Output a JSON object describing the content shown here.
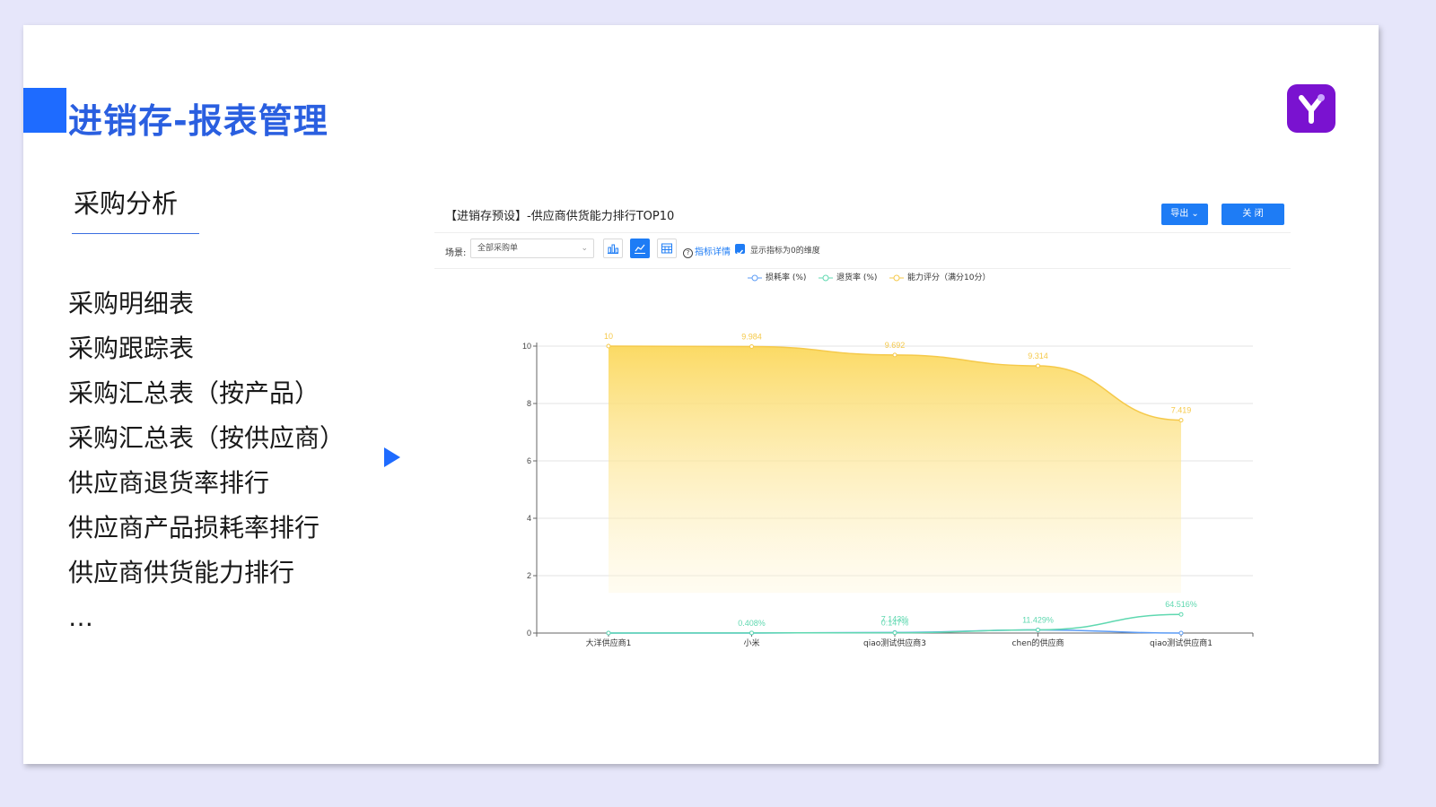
{
  "slide": {
    "title": "进销存-报表管理",
    "section_title": "采购分析",
    "menu_items": [
      "采购明细表",
      "采购跟踪表",
      "采购汇总表（按产品）",
      "采购汇总表（按供应商）",
      "供应商退货率排行",
      "供应商产品损耗率排行",
      "供应商供货能力排行",
      "…"
    ],
    "logo_icon": "y-logo-icon",
    "accent_color": "#1e6bff",
    "logo_color": "#7a12d0"
  },
  "panel": {
    "title": "【进销存预设】-供应商供货能力排行TOP10",
    "export_label": "导出",
    "close_label": "关 闭",
    "scene_label": "场景:",
    "scene_value": "全部采购单",
    "help_label": "指标详情",
    "checkbox_label": "显示指标为0的维度",
    "checkbox_checked": true,
    "active_view": "line-chart"
  },
  "chart_data": {
    "type": "area",
    "categories": [
      "大洋供应商1",
      "小米",
      "qiao测试供应商3",
      "chen的供应商",
      "qiao测试供应商1"
    ],
    "ylim": [
      0,
      10
    ],
    "yticks": [
      0,
      2,
      4,
      6,
      8,
      10
    ],
    "grid": true,
    "legend_placement": "top-center",
    "series": [
      {
        "name": "损耗率 (%)",
        "color": "#5b9bf5",
        "values": [
          0,
          0,
          0.02,
          0.11,
          0
        ],
        "labels": [
          "",
          "",
          "",
          "",
          ""
        ]
      },
      {
        "name": "退货率 (%)",
        "color": "#5fd8b0",
        "values": [
          0,
          0.004,
          0.01,
          0.11,
          0.65
        ],
        "labels": [
          "",
          "0.408%",
          "0.147%",
          "11.429%",
          "64.516%"
        ]
      },
      {
        "name": "能力评分（满分10分）",
        "color": "#f5c94a",
        "values": [
          10,
          9.984,
          9.692,
          9.314,
          7.419
        ],
        "labels": [
          "10",
          "9.984",
          "9.692",
          "9.314",
          "7.419"
        ]
      }
    ],
    "overlap_labels": [
      "7.143%"
    ]
  }
}
